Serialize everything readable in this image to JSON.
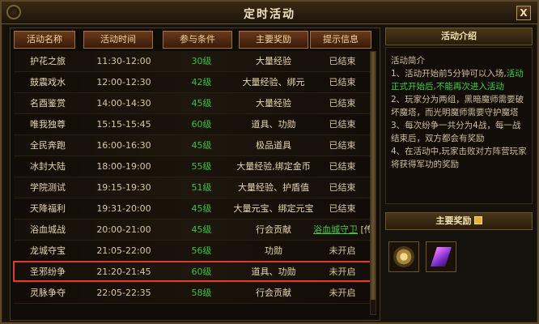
{
  "window": {
    "title": "定时活动",
    "close_label": "X"
  },
  "table": {
    "headers": [
      "活动名称",
      "活动时间",
      "参与条件",
      "主要奖励",
      "提示信息"
    ],
    "rows": [
      {
        "name": "护花之旅",
        "time": "11:30-12:00",
        "level": "30级",
        "reward": "大量经验",
        "status": "已结束"
      },
      {
        "name": "鼓震戏水",
        "time": "12:00-12:30",
        "level": "42级",
        "reward": "大量经验、绑元",
        "status": "已结束"
      },
      {
        "name": "名酉鉴赏",
        "time": "14:00-14:30",
        "level": "45级",
        "reward": "大量经验",
        "status": "已结束"
      },
      {
        "name": "唯我独尊",
        "time": "15:15-15:45",
        "level": "60级",
        "reward": "道具、功勋",
        "status": "已结束"
      },
      {
        "name": "全民奔跑",
        "time": "16:00-16:30",
        "level": "45级",
        "reward": "极品道具",
        "status": "已结束"
      },
      {
        "name": "冰封大陆",
        "time": "18:00-19:00",
        "level": "55级",
        "reward": "大量经验,绑定金币",
        "status": "已结束"
      },
      {
        "name": "学院测试",
        "time": "19:15-19:30",
        "level": "51级",
        "reward": "大量经验、护盾值",
        "status": "已结束"
      },
      {
        "name": "天降福利",
        "time": "19:31-20:00",
        "level": "45级",
        "reward": "大量元宝、绑定元宝",
        "status": "已结束"
      },
      {
        "name": "浴血城战",
        "time": "20:00-21:00",
        "level": "45级",
        "reward": "行会贡献",
        "status_link": "浴血城守卫",
        "status_suffix": "[传]"
      },
      {
        "name": "龙城夺宝",
        "time": "21:05-22:00",
        "level": "56级",
        "reward": "功勋",
        "status": "未开启"
      },
      {
        "name": "圣邪纷争",
        "time": "21:20-21:45",
        "level": "60级",
        "reward": "道具、功勋",
        "status": "未开启"
      },
      {
        "name": "灵脉争夺",
        "time": "22:05-22:35",
        "level": "58级",
        "reward": "行会贡献",
        "status": "未开启"
      }
    ]
  },
  "intro": {
    "heading": "活动介绍",
    "title": "活动简介",
    "p1_a": "1、活动开始前5分钟可以入场,",
    "p1_b": "活动正式开始后,不能再次进入活动",
    "p2": "2、玩家分为两组，黑暗魔师需要破坏魔塔，而光明魔师需要守护魔塔",
    "p3": "3、每次纷争一共分为4战，每一战结束后，双方都会有奖励",
    "p4": "4、在活动中,玩家击败对方阵营玩家将获得军功的奖励"
  },
  "rewards": {
    "heading": "主要奖励",
    "items": [
      {
        "icon": "medal-icon"
      },
      {
        "icon": "crystal-icon"
      }
    ]
  },
  "colors": {
    "level_green": "#3ac43a",
    "highlight_red": "#e23a2a",
    "accent_gold": "#a07040"
  }
}
